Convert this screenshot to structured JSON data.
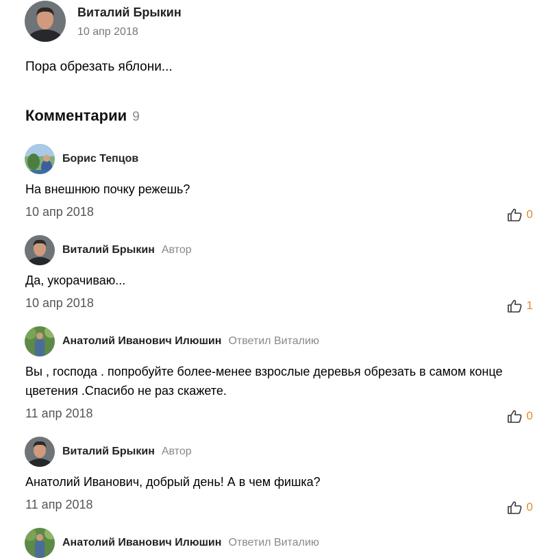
{
  "post": {
    "author": "Виталий Брыкин",
    "date": "10 апр 2018",
    "text": "Пора обрезать яблони..."
  },
  "comments_header": {
    "title": "Комментарии",
    "count": "9"
  },
  "comments": [
    {
      "author": "Борис Тепцов",
      "role": "",
      "text": "На внешнюю почку режешь?",
      "date": "10 апр 2018",
      "likes": "0"
    },
    {
      "author": "Виталий Брыкин",
      "role": "Автор",
      "text": "Да, укорачиваю...",
      "date": "10 апр 2018",
      "likes": "1"
    },
    {
      "author": "Анатолий Иванович Илюшин",
      "role": "Ответил Виталию",
      "text": "Вы , господа . попробуйте более-менее взрослые деревья обрезать в самом конце цветения .Спасибо не раз скажете.",
      "date": "11 апр 2018",
      "likes": "0"
    },
    {
      "author": "Виталий Брыкин",
      "role": "Автор",
      "text": "Анатолий Иванович, добрый день! А в чем фишка?",
      "date": "11 апр 2018",
      "likes": "0"
    },
    {
      "author": "Анатолий Иванович Илюшин",
      "role": "Ответил Виталию",
      "text": "",
      "date": "",
      "likes": ""
    }
  ],
  "icons": {
    "like": "thumbs-up-icon"
  },
  "colors": {
    "like_count": "#e08b2e",
    "meta_gray": "#888888"
  }
}
